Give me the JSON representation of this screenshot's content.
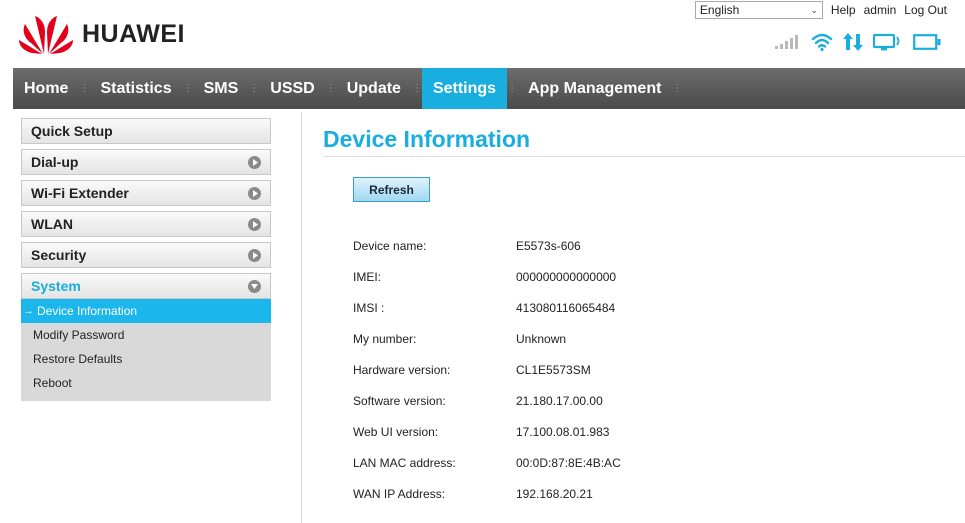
{
  "brand": {
    "name": "HUAWEI",
    "logo_color": "#e3001b"
  },
  "topbar": {
    "language": "English",
    "help": "Help",
    "user": "admin",
    "logout": "Log Out"
  },
  "status_icons": [
    "signal-icon",
    "wifi-icon",
    "data-transfer-icon",
    "display-icon",
    "battery-icon"
  ],
  "accent_color": "#1aaee0",
  "nav": {
    "items": [
      {
        "label": "Home"
      },
      {
        "label": "Statistics"
      },
      {
        "label": "SMS"
      },
      {
        "label": "USSD"
      },
      {
        "label": "Update"
      },
      {
        "label": "Settings",
        "active": true
      },
      {
        "label": "App Management"
      }
    ]
  },
  "sidebar": {
    "quick_setup": "Quick Setup",
    "dialup": "Dial-up",
    "wifi_extender": "Wi-Fi Extender",
    "wlan": "WLAN",
    "security": "Security",
    "system": "System",
    "system_items": [
      {
        "label": "Device Information",
        "active": true
      },
      {
        "label": "Modify Password"
      },
      {
        "label": "Restore Defaults"
      },
      {
        "label": "Reboot"
      }
    ]
  },
  "main": {
    "title": "Device Information",
    "refresh_label": "Refresh",
    "rows": [
      {
        "label": "Device name:",
        "value": "E5573s-606"
      },
      {
        "label": "IMEI:",
        "value": "000000000000000"
      },
      {
        "label": "IMSI :",
        "value": "413080116065484"
      },
      {
        "label": "My number:",
        "value": "Unknown"
      },
      {
        "label": "Hardware version:",
        "value": "CL1E5573SM"
      },
      {
        "label": "Software version:",
        "value": "21.180.17.00.00"
      },
      {
        "label": "Web UI version:",
        "value": "17.100.08.01.983"
      },
      {
        "label": "LAN MAC address:",
        "value": "00:0D:87:8E:4B:AC"
      },
      {
        "label": "WAN IP Address:",
        "value": "192.168.20.21"
      }
    ]
  }
}
